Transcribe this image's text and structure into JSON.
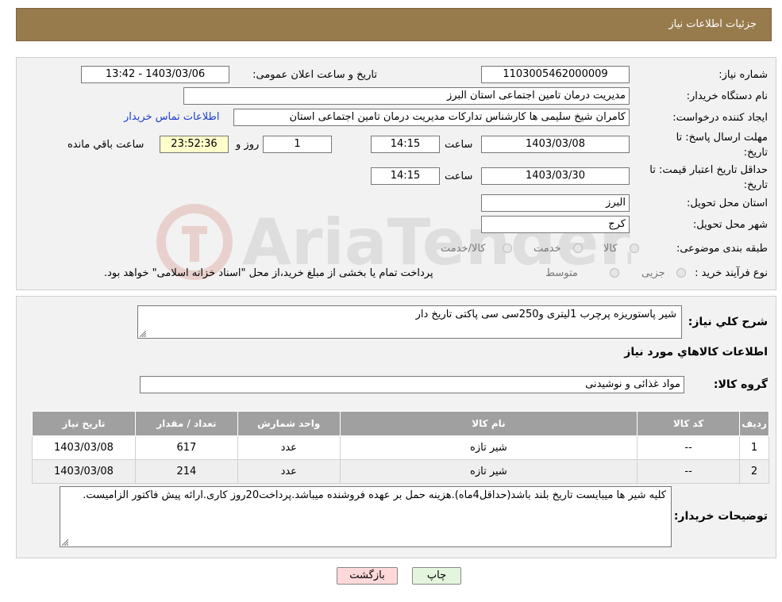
{
  "header": {
    "title": "جزئیات اطلاعات نیاز"
  },
  "form": {
    "need_number_label": "شماره نیاز:",
    "need_number": "1103005462000009",
    "announce_label": "تاریخ و ساعت اعلان عمومی:",
    "announce_value": "1403/03/06 - 13:42",
    "buyer_org_label": "نام دستگاه خریدار:",
    "buyer_org": "مدیریت درمان تامین اجتماعی استان البرز",
    "creator_label": "ایجاد کننده درخواست:",
    "creator": "کامران شیخ سلیمی ها کارشناس تدارکات مدیریت درمان تامین اجتماعی استان",
    "contact_link": "اطلاعات تماس خریدار",
    "deadline_label": "مهلت ارسال پاسخ: تا تاریخ:",
    "deadline_date": "1403/03/08",
    "time_label": "ساعت",
    "deadline_time": "14:15",
    "days_value": "1",
    "days_label": "روز و",
    "remaining_time": "23:52:36",
    "remaining_label": "ساعت باقي مانده",
    "validity_label": "حداقل تاریخ اعتبار قیمت: تا تاریخ:",
    "validity_date": "1403/03/30",
    "validity_time": "14:15",
    "province_label": "استان محل تحویل:",
    "province": "البرز",
    "city_label": "شهر محل تحویل:",
    "city": "کرج",
    "category_label": "طبقه بندی موضوعی:",
    "category_options": [
      "کالا",
      "خدمت",
      "کالا/خدمت"
    ],
    "process_label": "نوع فرآیند خرید :",
    "process_options": [
      "جزیی",
      "متوسط"
    ],
    "payment_note": "پرداخت تمام یا بخشی از مبلغ خرید،از محل \"اسناد خزانه اسلامی\" خواهد بود."
  },
  "details": {
    "summary_label": "شرح کلي نياز:",
    "summary": "شیر پاستوریزه پرچرب 1لیتری و250سی سی  پاکتی تاریخ دار",
    "items_heading": "اطلاعات کالاهاي مورد نياز",
    "group_label": "گروه کالا:",
    "group": "مواد غذائی و نوشیدنی",
    "table": {
      "headers": [
        "رديف",
        "کد کالا",
        "نام کالا",
        "واحد شمارش",
        "تعداد / مقدار",
        "تاريخ نياز"
      ],
      "rows": [
        [
          "1",
          "--",
          "شیر تازه",
          "عدد",
          "617",
          "1403/03/08"
        ],
        [
          "2",
          "--",
          "شیر تازه",
          "عدد",
          "214",
          "1403/03/08"
        ]
      ]
    },
    "buyer_notes_label": "توضیحات خریدار:",
    "buyer_notes": "کلیه شیر ها میبایست تاریخ بلند باشد(حداقل4ماه).هزینه حمل بر عهده فروشنده میباشد.پرداخت20روز کاری.ارائه پیش فاکتور الزامیست."
  },
  "buttons": {
    "print": "چاپ",
    "back": "بازگشت"
  },
  "watermark": {
    "text": "AriaTender.neT"
  },
  "colors": {
    "header_bg": "#987b4d",
    "table_header_bg": "#a0a0a0",
    "link": "#1a3fcc",
    "back_button_bg": "#ffd9d9",
    "print_button_bg": "#e3f5dc"
  }
}
